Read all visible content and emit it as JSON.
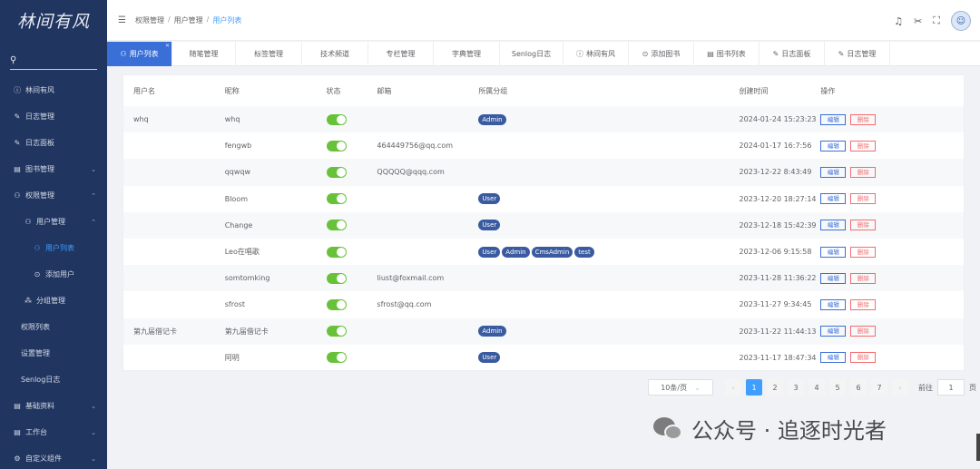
{
  "brand": {
    "logo_text": "林间有风"
  },
  "sidebar": {
    "search_icon": "search-icon",
    "items": [
      {
        "label": "林间有风",
        "icon": "info-icon"
      },
      {
        "label": "日志管理",
        "icon": "edit-icon"
      },
      {
        "label": "日志面板",
        "icon": "edit-icon"
      },
      {
        "label": "图书管理",
        "icon": "book-icon",
        "arrow": "⌄"
      },
      {
        "label": "权限管理",
        "icon": "user-lock-icon",
        "arrow": "⌃"
      },
      {
        "label": "用户管理",
        "icon": "user-lock-icon",
        "arrow": "⌃"
      },
      {
        "label": "用户列表",
        "icon": "user-lock-icon"
      },
      {
        "label": "添加用户",
        "icon": "plus-circle-icon"
      },
      {
        "label": "分组管理",
        "icon": "group-icon"
      },
      {
        "label": "权限列表"
      },
      {
        "label": "设置管理"
      },
      {
        "label": "Senlog日志"
      },
      {
        "label": "基础资料",
        "icon": "book-icon",
        "arrow": "⌄"
      },
      {
        "label": "工作台",
        "icon": "book-icon",
        "arrow": "⌄"
      },
      {
        "label": "自定义组件",
        "icon": "gear-icon",
        "arrow": "⌄"
      }
    ]
  },
  "header": {
    "breadcrumb": [
      "权限管理",
      "用户管理",
      "用户列表"
    ],
    "icons": [
      "bell-icon",
      "tools-icon",
      "fullscreen-icon",
      "avatar"
    ]
  },
  "tabs": [
    "用户列表",
    "随笔管理",
    "标签管理",
    "技术频道",
    "专栏管理",
    "字典管理",
    "Senlog日志",
    "林间有风",
    "添加图书",
    "图书列表",
    "日志面板",
    "日志管理"
  ],
  "table": {
    "columns": [
      "用户名",
      "昵称",
      "状态",
      "邮箱",
      "所属分组",
      "创建时间",
      "操作"
    ],
    "edit_label": "编辑",
    "delete_label": "删除",
    "rows": [
      {
        "username": "whq",
        "nickname": "whq",
        "email": "",
        "groups": [
          "Admin"
        ],
        "created": "2024-01-24 15:23:23"
      },
      {
        "username": "",
        "nickname": "fengwb",
        "email": "464449756@qq.com",
        "groups": [],
        "created": "2024-01-17 16:7:56"
      },
      {
        "username": "",
        "nickname": "qqwqw",
        "email": "QQQQQ@qqq.com",
        "groups": [],
        "created": "2023-12-22 8:43:49"
      },
      {
        "username": "",
        "nickname": "Bloom",
        "email": "",
        "groups": [
          "User"
        ],
        "created": "2023-12-20 18:27:14"
      },
      {
        "username": "",
        "nickname": "Change",
        "email": "",
        "groups": [
          "User"
        ],
        "created": "2023-12-18 15:42:39"
      },
      {
        "username": "",
        "nickname": "Leo在唱歌",
        "email": "",
        "groups": [
          "User",
          "Admin",
          "CmsAdmin",
          "test"
        ],
        "created": "2023-12-06 9:15:58"
      },
      {
        "username": "",
        "nickname": "somtomking",
        "email": "liust@foxmail.com",
        "groups": [],
        "created": "2023-11-28 11:36:22"
      },
      {
        "username": "",
        "nickname": "sfrost",
        "email": "sfrost@qq.com",
        "groups": [],
        "created": "2023-11-27 9:34:45"
      },
      {
        "username": "第九届借记卡",
        "nickname": "第九届借记卡",
        "email": "",
        "groups": [
          "Admin"
        ],
        "created": "2023-11-22 11:44:13"
      },
      {
        "username": "",
        "nickname": "阿明",
        "email": "",
        "groups": [
          "User"
        ],
        "created": "2023-11-17 18:47:34"
      }
    ]
  },
  "pagination": {
    "page_size": "10条/页",
    "pages": [
      "1",
      "2",
      "3",
      "4",
      "5",
      "6",
      "7"
    ],
    "current": "1",
    "goto_label": "前往",
    "goto_value": "1",
    "page_suffix": "页"
  },
  "watermark": {
    "text": "公众号 · 追逐时光者"
  }
}
